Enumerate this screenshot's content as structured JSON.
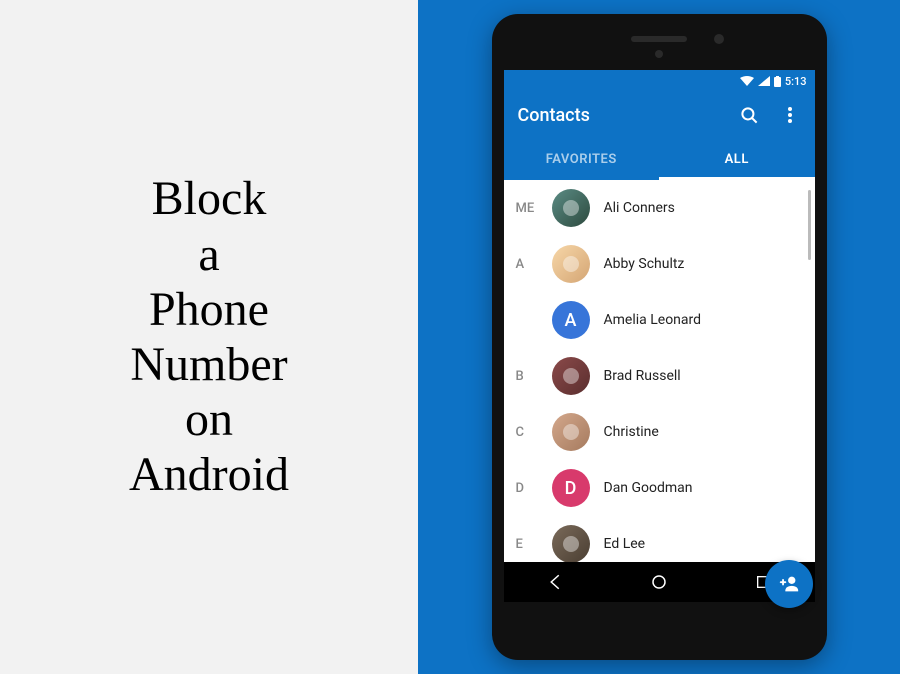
{
  "headline": {
    "line1": "Block",
    "line2": "a",
    "line3": "Phone",
    "line4": "Number",
    "line5": "on",
    "line6": "Android"
  },
  "status_bar": {
    "time": "5:13"
  },
  "app_bar": {
    "title": "Contacts"
  },
  "tabs": {
    "favorites": "FAVORITES",
    "all": "ALL"
  },
  "contacts": [
    {
      "section": "ME",
      "name": "Ali Conners",
      "avatar_type": "photo",
      "avatar_class": "av-photo1",
      "letter": ""
    },
    {
      "section": "A",
      "name": "Abby Schultz",
      "avatar_type": "photo",
      "avatar_class": "av-photo2",
      "letter": ""
    },
    {
      "section": "",
      "name": "Amelia Leonard",
      "avatar_type": "letter",
      "avatar_class": "av-letter-a",
      "letter": "A"
    },
    {
      "section": "B",
      "name": "Brad Russell",
      "avatar_type": "photo",
      "avatar_class": "av-photo3",
      "letter": ""
    },
    {
      "section": "C",
      "name": "Christine",
      "avatar_type": "photo",
      "avatar_class": "av-photo4",
      "letter": ""
    },
    {
      "section": "D",
      "name": "Dan Goodman",
      "avatar_type": "letter",
      "avatar_class": "av-letter-d",
      "letter": "D"
    },
    {
      "section": "E",
      "name": "Ed Lee",
      "avatar_type": "photo",
      "avatar_class": "av-photo5",
      "letter": ""
    }
  ]
}
